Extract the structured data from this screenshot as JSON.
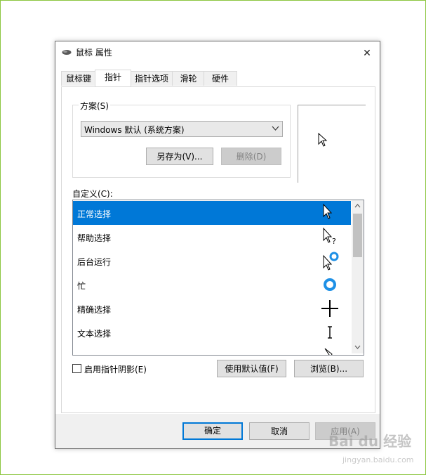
{
  "window": {
    "title": "鼠标 属性",
    "close_glyph": "✕"
  },
  "tabs": [
    {
      "label": "鼠标键",
      "active": false
    },
    {
      "label": "指针",
      "active": true
    },
    {
      "label": "指针选项",
      "active": false
    },
    {
      "label": "滑轮",
      "active": false
    },
    {
      "label": "硬件",
      "active": false
    }
  ],
  "scheme": {
    "group_label": "方案(S)",
    "selected": "Windows 默认 (系统方案)",
    "save_as_label": "另存为(V)...",
    "delete_label": "删除(D)"
  },
  "customize": {
    "label": "自定义(C):",
    "items": [
      {
        "label": "正常选择",
        "icon": "arrow-cursor-icon",
        "selected": true
      },
      {
        "label": "帮助选择",
        "icon": "help-select-cursor-icon",
        "selected": false
      },
      {
        "label": "后台运行",
        "icon": "working-in-background-cursor-icon",
        "selected": false
      },
      {
        "label": "忙",
        "icon": "busy-cursor-icon",
        "selected": false
      },
      {
        "label": "精确选择",
        "icon": "precision-select-cursor-icon",
        "selected": false
      },
      {
        "label": "文本选择",
        "icon": "text-select-cursor-icon",
        "selected": false
      }
    ]
  },
  "options": {
    "shadow_checkbox_label": "启用指针阴影(E)",
    "shadow_checked": false,
    "use_default_label": "使用默认值(F)",
    "browse_label": "浏览(B)..."
  },
  "footer": {
    "ok_label": "确定",
    "cancel_label": "取消",
    "apply_label": "应用(A)"
  },
  "watermark": {
    "text": "Bai du 经验",
    "sub": "jingyan.baidu.com"
  },
  "colors": {
    "accent": "#0078d7",
    "frame": "#8cc63f"
  }
}
